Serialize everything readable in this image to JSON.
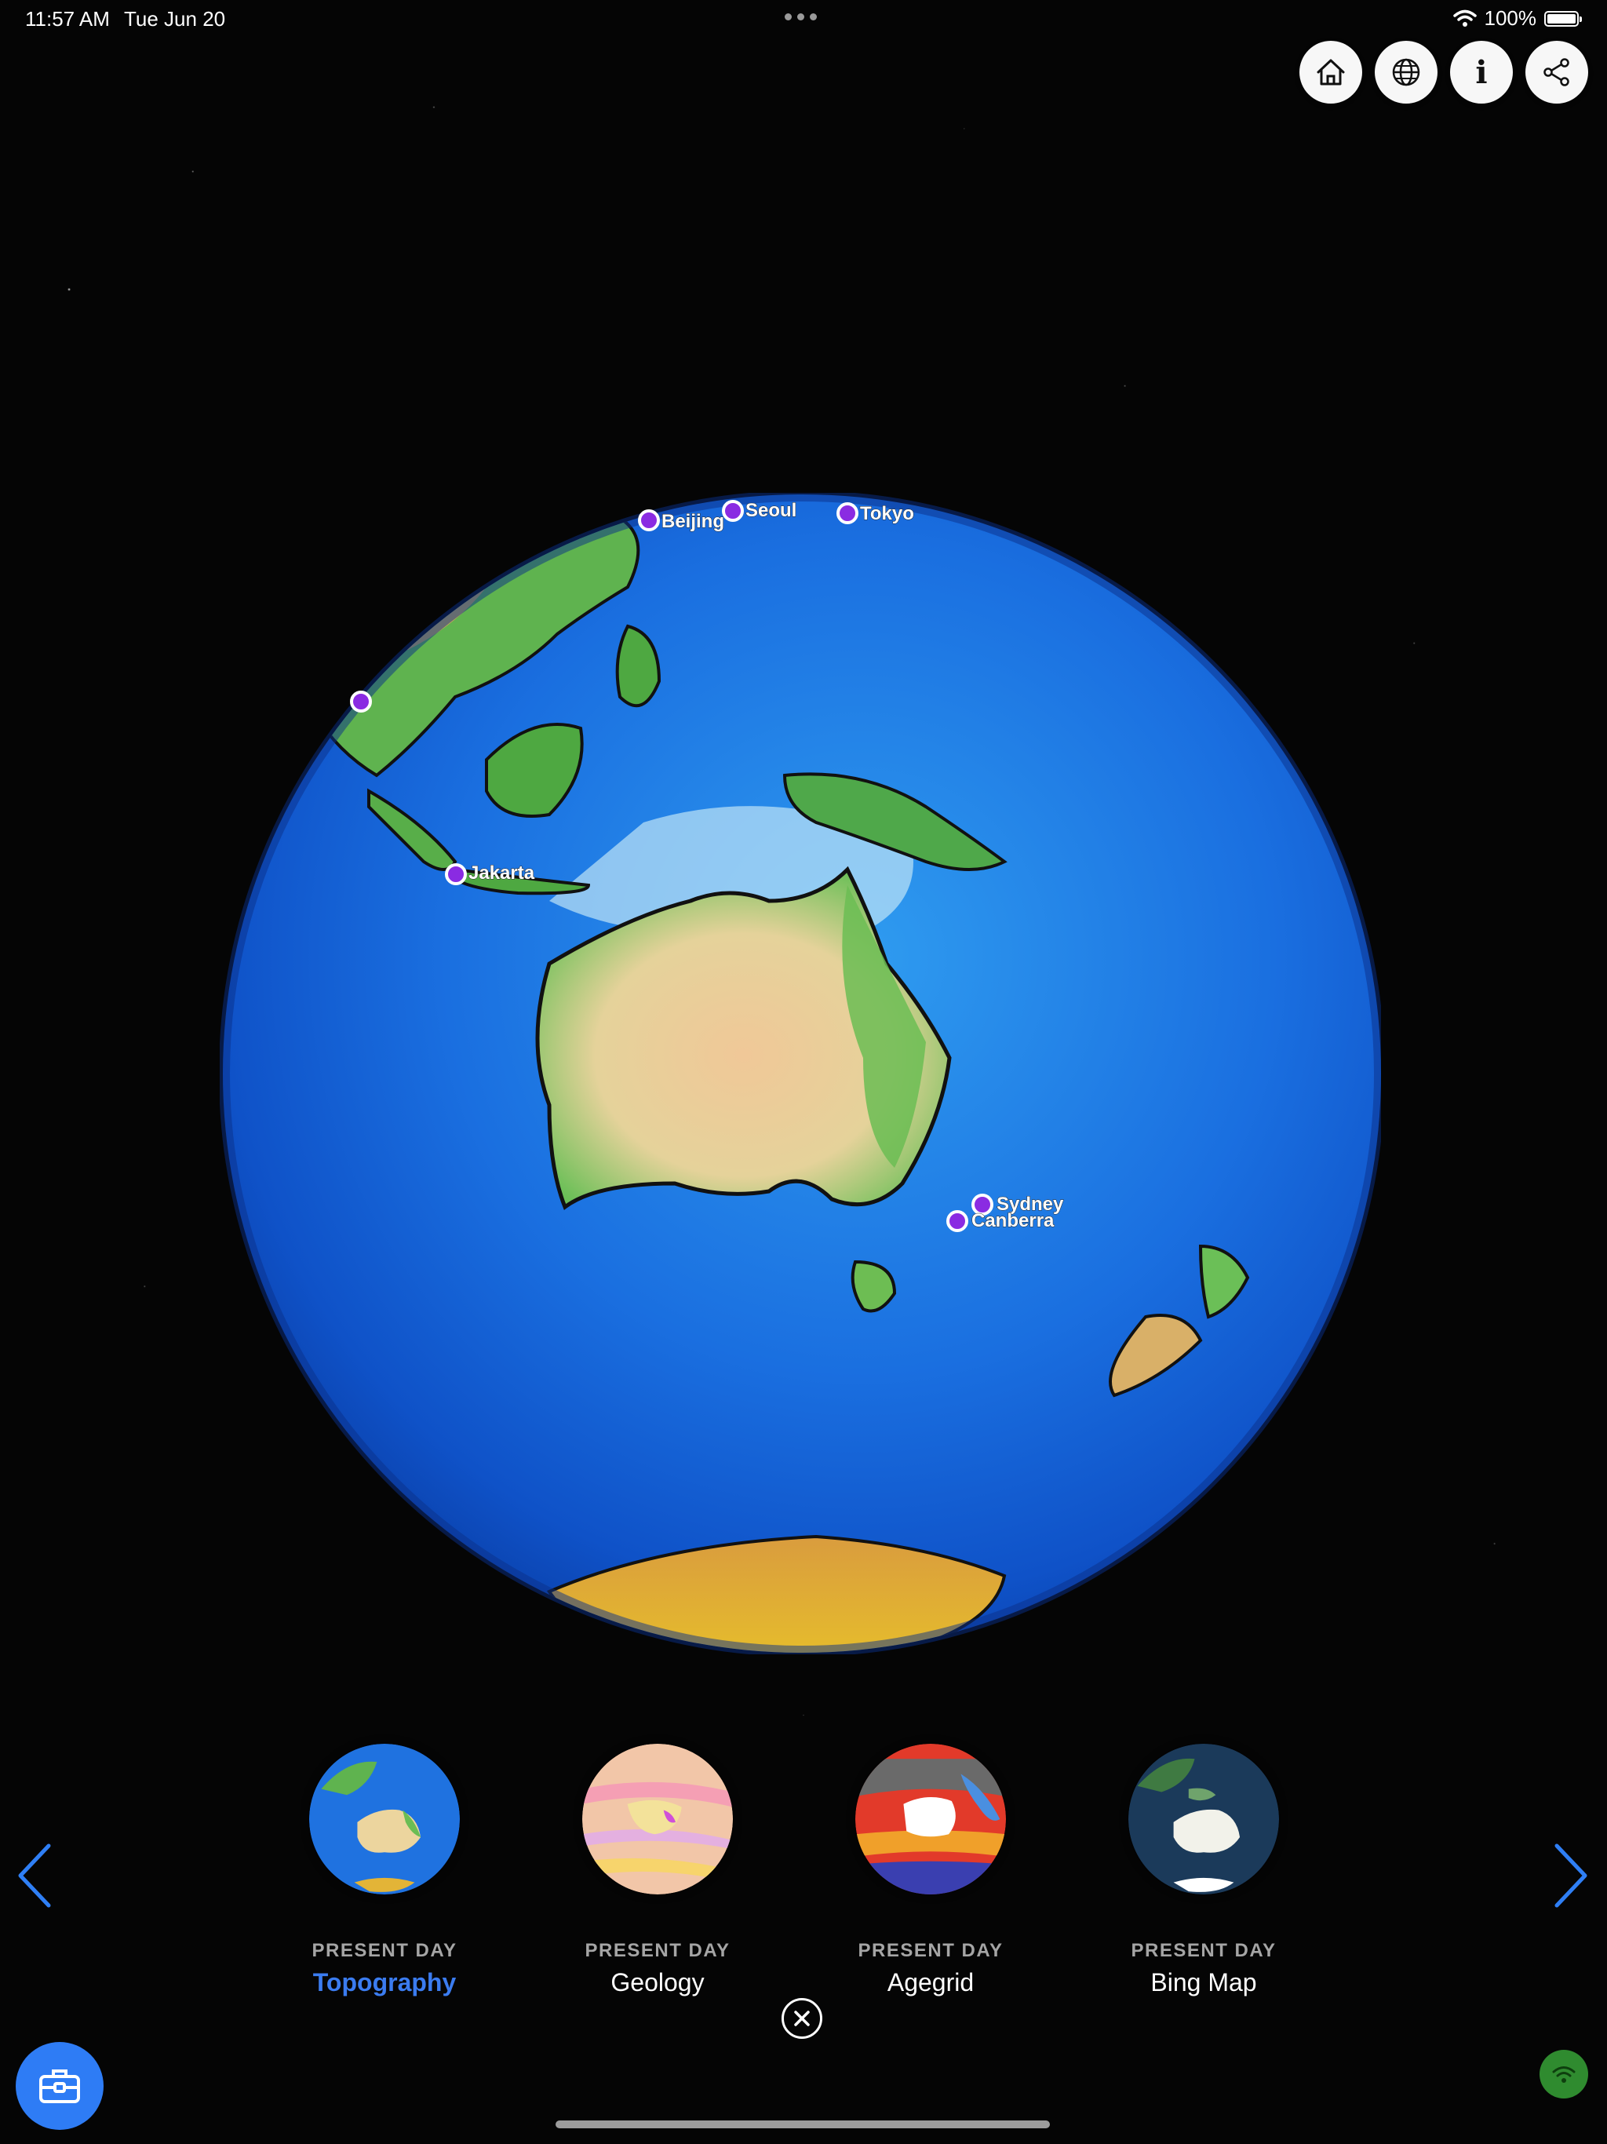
{
  "status_bar": {
    "time": "11:57 AM",
    "date": "Tue Jun 20",
    "battery_text": "100%",
    "icons": [
      "wifi-icon",
      "battery-icon",
      "multitasking-dots-icon"
    ]
  },
  "top_actions": [
    {
      "name": "home-button",
      "icon": "home-icon"
    },
    {
      "name": "globe-button",
      "icon": "globe-icon"
    },
    {
      "name": "info-button",
      "icon": "info-icon",
      "glyph": "i"
    },
    {
      "name": "share-button",
      "icon": "share-icon"
    }
  ],
  "globe": {
    "view": "Oceania / Australia centered",
    "marker_color": "#8a2be2",
    "cities": [
      "Beijing",
      "Seoul",
      "Tokyo",
      "Jakarta",
      "Sydney",
      "Canberra"
    ]
  },
  "layers": [
    {
      "kicker": "PRESENT DAY",
      "name": "Topography",
      "selected": true
    },
    {
      "kicker": "PRESENT DAY",
      "name": "Geology",
      "selected": false
    },
    {
      "kicker": "PRESENT DAY",
      "name": "Agegrid",
      "selected": false
    },
    {
      "kicker": "PRESENT DAY",
      "name": "Bing Map",
      "selected": false
    }
  ],
  "colors": {
    "accent": "#3b7cf0",
    "toolbox_button": "#2e7cf5",
    "network_badge": "#2f8b2f"
  },
  "icons": {
    "prev": "chevron-left-icon",
    "next": "chevron-right-icon",
    "close": "close-circle-icon",
    "toolbox": "toolbox-icon",
    "network": "wifi-signal-icon"
  }
}
